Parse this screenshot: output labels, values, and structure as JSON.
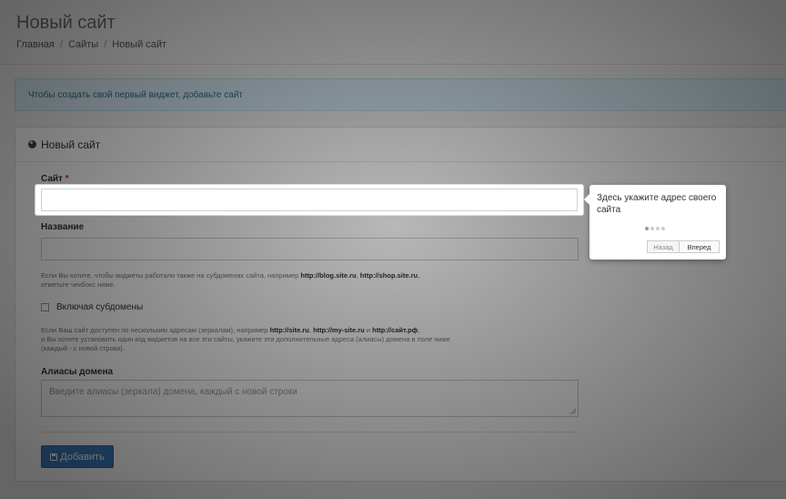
{
  "header": {
    "title": "Новый сайт",
    "breadcrumbs": [
      "Главная",
      "Сайты",
      "Новый сайт"
    ],
    "separator": "/"
  },
  "alert": {
    "text": "Чтобы создать свой первый виджет, добавьте сайт"
  },
  "panel": {
    "title": "Новый сайт",
    "title_icon": "globe-icon",
    "site_label": "Сайт",
    "required_mark": "*",
    "site_value": "",
    "name_label": "Название",
    "name_value": "",
    "help_subdomains_pre": "Если Вы хотите, чтобы виджеты работали также на субдоменах сайта, например",
    "help_subdomains_ex1": "http://blog.site.ru",
    "help_subdomains_comma": ",",
    "help_subdomains_ex2": "http://shop.site.ru",
    "help_subdomains_post": ",",
    "help_subdomains_line2": "отметьте чекбокс ниже.",
    "checkbox_label": "Включая субдомены",
    "checkbox_checked": false,
    "help_aliases_pre": "Если Ваш сайт доступен по нескольким адресам (зеркалам), например",
    "help_aliases_ex1": "http://site.ru",
    "help_aliases_comma": ",",
    "help_aliases_ex2": "http://my-site.ru",
    "help_aliases_and": "и",
    "help_aliases_ex3": "http://сайт.рф",
    "help_aliases_end": ",",
    "help_aliases_line2": "и Вы хотите установить один код виджетов на все эти сайты, укажите эти дополнительные адреса (алиасы) домена в поле ниже",
    "help_aliases_line3": "(каждый - с новой строки).",
    "aliases_label": "Алиасы домена",
    "aliases_placeholder": "Введите алиасы (зеркала) домена, каждый с новой строки",
    "add_button": "Добавить",
    "add_button_icon": "save-icon"
  },
  "tour": {
    "text": "Здесь укажите адрес своего сайта",
    "step": 1,
    "steps_total": 4,
    "back_label": "Назад",
    "next_label": "Вперед"
  },
  "colors": {
    "primary_button": "#3a7bbf",
    "alert_bg": "#d9edf7",
    "alert_text": "#31708f",
    "required": "#c9302c"
  }
}
